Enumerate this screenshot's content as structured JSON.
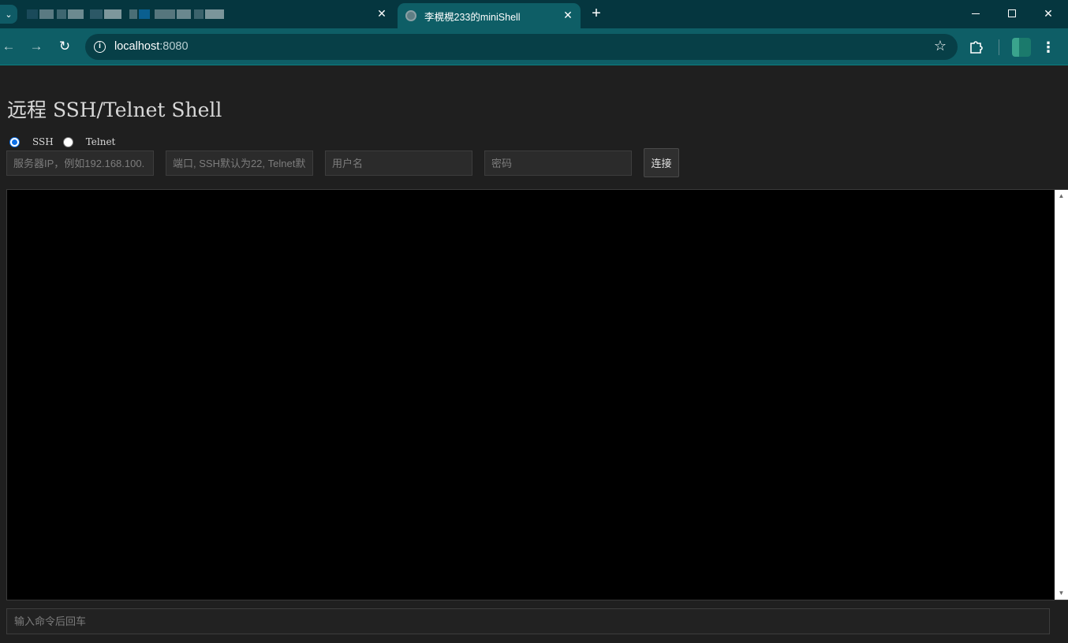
{
  "browser": {
    "active_tab": {
      "title": "李榥榥233的miniShell",
      "favicon": "globe-icon"
    },
    "inactive_tab": {
      "blurred_colors": [
        "#1a4a5a",
        "#5a7a82",
        "#3e6670",
        "#6c8a90",
        "#2c5866",
        "#7d979c",
        "#4a6e76",
        "#0a5f8f",
        "#56767d",
        "#6a888e",
        "#3b636c",
        "#7b959a"
      ]
    },
    "address": {
      "host": "localhost",
      "port": ":8080"
    },
    "icons": {
      "back": "arrow-left-icon",
      "forward": "arrow-right-icon",
      "reload": "reload-icon",
      "info": "info-icon",
      "bookmark": "star-icon",
      "extensions": "puzzle-icon",
      "menu": "more-vert-icon"
    }
  },
  "app": {
    "title": "远程 SSH/Telnet Shell",
    "protocols": [
      {
        "label": "SSH",
        "checked": true
      },
      {
        "label": "Telnet",
        "checked": false
      }
    ],
    "fields": {
      "host_placeholder": "服务器IP，例如192.168.100.",
      "port_placeholder": "端口, SSH默认为22, Telnet默",
      "user_placeholder": "用户名",
      "password_placeholder": "密码"
    },
    "connect_label": "连接",
    "command_placeholder": "输入命令后回车"
  },
  "colors": {
    "chrome_dark": "#05363f",
    "chrome_active": "#0e5e66",
    "page_background": "#1f1f1f",
    "terminal_background": "#000000",
    "radio_accent": "#0b6fe8"
  }
}
